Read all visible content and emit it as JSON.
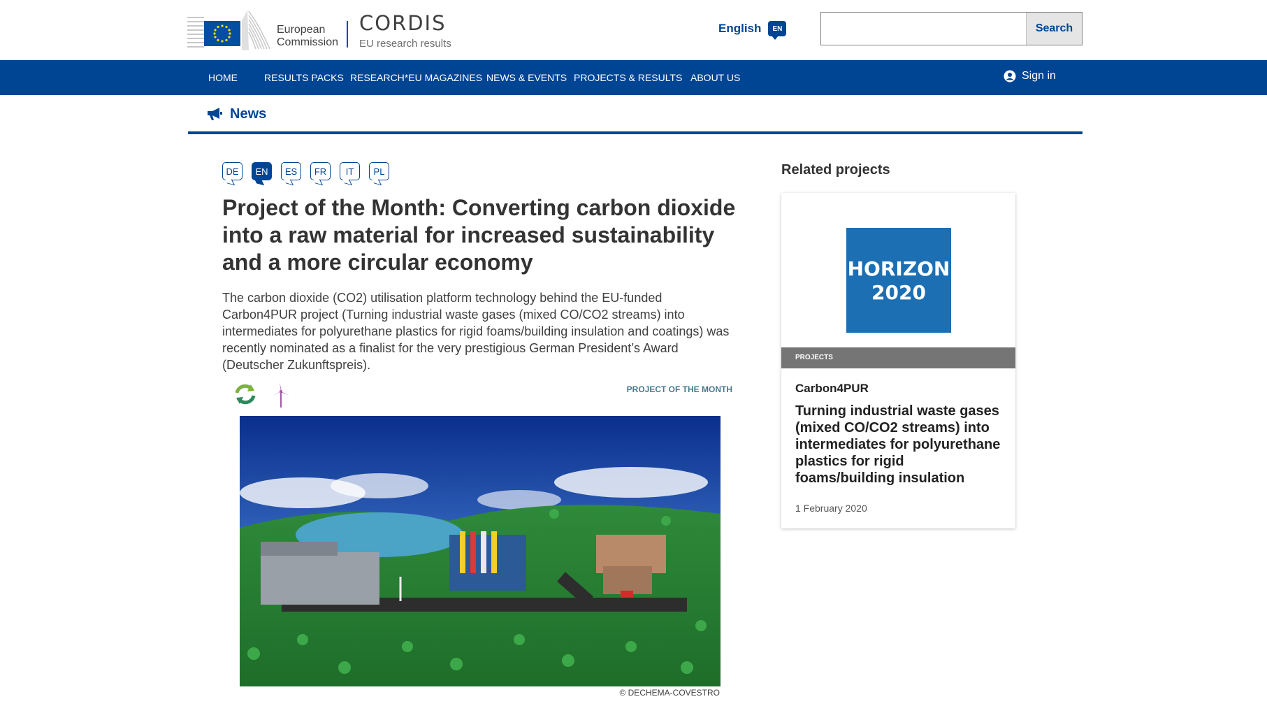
{
  "header": {
    "org_line1": "European",
    "org_line2": "Commission",
    "site_title": "CORDIS",
    "site_subtitle": "EU research results",
    "language_label": "English",
    "language_code": "EN",
    "search_placeholder": "",
    "search_button": "Search"
  },
  "nav": {
    "items": [
      "HOME",
      "RESULTS PACKS",
      "RESEARCH*EU MAGAZINES",
      "NEWS & EVENTS",
      "PROJECTS & RESULTS",
      "ABOUT US"
    ],
    "signin": "Sign in"
  },
  "section": {
    "title": "News"
  },
  "languages": [
    "DE",
    "EN",
    "ES",
    "FR",
    "IT",
    "PL"
  ],
  "article": {
    "title": "Project of the Month: Converting carbon dioxide into a raw material for increased sustainability and a more circular economy",
    "lead": "The carbon dioxide (CO2) utilisation platform technology behind the EU-funded Carbon4PUR project (Turning industrial waste gases (mixed CO/CO2 streams) into intermediates for polyurethane plastics for rigid foams/building insulation and coatings) was recently nominated as a finalist for the very prestigious German President’s Award (Deutscher Zukunftspreis).",
    "tag": "PROJECT OF THE MONTH",
    "icons": [
      "recycle-icon",
      "wind-turbine-icon"
    ],
    "image_credit": "© DECHEMA-COVESTRO"
  },
  "related": {
    "heading": "Related projects",
    "card": {
      "logo_line1": "HORIZON",
      "logo_line2": "2020",
      "strip": "PROJECTS",
      "acronym": "Carbon4PUR",
      "description": "Turning industrial waste gases (mixed CO/CO2 streams) into intermediates for polyurethane plastics for rigid foams/building insulation and…",
      "date": "1 February 2020"
    }
  },
  "colors": {
    "primary": "#004494",
    "tag": "#467a8c",
    "h2020": "#1d6fb3"
  }
}
